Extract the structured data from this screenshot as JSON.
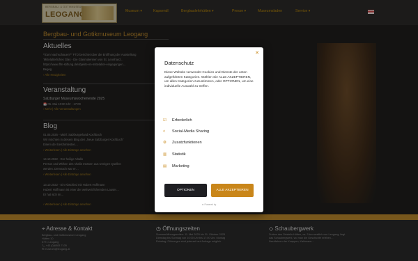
{
  "header": {
    "logo_small": "BERGBAU- & GOTIKMUSEUM",
    "logo_big": "LEOGANG",
    "nav": [
      {
        "label": "Museum ▾"
      },
      {
        "label": "Kapsendl"
      },
      {
        "label": "Bergbaulehrhütten ▾"
      },
      {
        "label": "Presse ▾"
      },
      {
        "label": "Museumsladen"
      },
      {
        "label": "Service ▾"
      }
    ]
  },
  "page": {
    "title": "Bergbau- und Gotikmuseum Leogang",
    "sections": {
      "aktuelles": "Aktuelles",
      "veranstaltung": "Veranstaltung",
      "blog": "Blog"
    },
    "aktuelles_lines": [
      "❝Zum Nachschauen!❞ 'FTD berichtet über die Eröffnung der Ausstellung",
      "'Mittelalterliches Glas - Die Glasmalereien von St. Leonhard…",
      "https://www.ffm-stiftung.de/objekte-im-mittelalter-eingegangen…",
      "Begeg"
    ],
    "aktuelles_link": "› Alle Neuigkeiten",
    "veranstaltung_lines": [
      "Salzburger Museumswochenende 2025",
      "📅 05. Mai 10:00 Uhr - 17:00"
    ],
    "veranstaltung_link": "› Mehr | Alle Veranstaltungen",
    "blog_entries": [
      {
        "date": "01.05.2025 - Mahl: Salzburgerland Kochbuch",
        "text": [
          "Wir möchten in diesem Blog den „Neue Salzburger Kochbuch“",
          "Einem der berühmtesten…"
        ],
        "link": "› Weiterlesen | Alle Einträge ansehen"
      },
      {
        "date": "14.10.2022 - Der heilige Vitalis",
        "text": [
          "Person und Wirken des Vitalis müssen aus wenigen Quellen",
          "werden. Demnach war er…"
        ],
        "link": "› Weiterlesen | Alle Einträge ansehen"
      },
      {
        "date": "13.10.2022 - Ein Abschied mit Hubert Hoffmann",
        "text": [
          "Hubert Hoffmann ist einer der weltweit führenden Lauser…",
          "Er hat sich im…"
        ],
        "link": "› Weiterlesen | Alle Einträge ansehen"
      }
    ]
  },
  "footer": {
    "col1_title": "Adresse & Kontakt",
    "col1_lines": [
      "Bergbau- und Gotikmuseum Leogang",
      "Hütten 10",
      "5771 Leogang",
      "📞 +43 (0)6583 7105",
      "✉ museum@leogang.at"
    ],
    "col2_title": "Öffnungszeiten",
    "col2_lines": [
      "Sommeröffnungszeiten: 11. Mai 2025 bis 31. Oktober 2025",
      "Dienstag bis Sonntag von 10:00 Uhr bis 17:00 Uhr. Montag",
      "Ruhetag. Führungen sind jederzeit auf Anfrage möglich."
    ],
    "col3_title": "Schaubergwerk",
    "col3_lines": [
      "Zudem des Ortsteils Hütten, ca. 5 km westlich von Leogang, liegt",
      "das Schaubergwerk, wo man die Geschichte erleben…",
      "Nachfahren der Knappen, Kalkmann…"
    ]
  },
  "modal": {
    "title": "Datenschutz",
    "description": "Diese Website verwendet Cookies und Dienste der unten aufgeführten Kategorien. Wählen Sie ALLE AKZEPTIEREN, um allen Kategorien zuzustimmen, oder OPTIONEN, um eine individuelle Auswahl zu treffen.",
    "categories": [
      {
        "label": "Erforderlich",
        "icon": "check-icon"
      },
      {
        "label": "Social-Media Sharing",
        "icon": "share-icon"
      },
      {
        "label": "Zusatzfunktionen",
        "icon": "gear-icon"
      },
      {
        "label": "Statistik",
        "icon": "chart-icon"
      },
      {
        "label": "Marketing",
        "icon": "megaphone-icon"
      }
    ],
    "options_label": "OPTIONEN",
    "accept_label": "ALLE AKZEPTIEREN",
    "powered": "⚙ Powered by"
  },
  "colors": {
    "accent": "#c9861a",
    "dark_button": "#1e1e22",
    "page_bg": "#1f1e1c"
  }
}
